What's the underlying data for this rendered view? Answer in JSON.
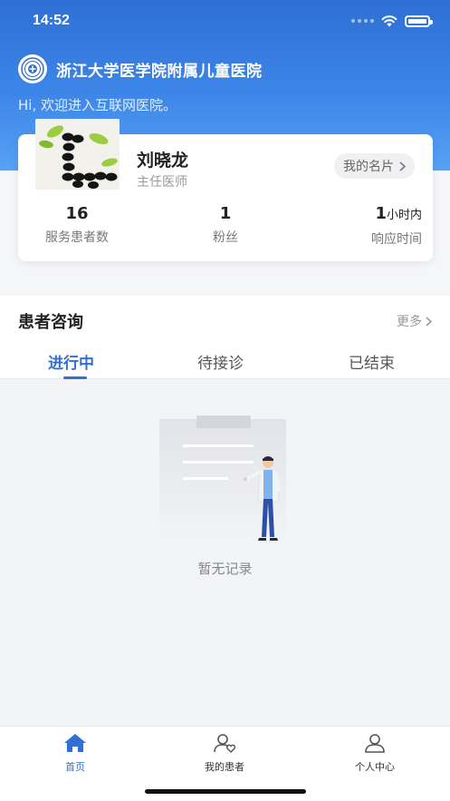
{
  "status_bar": {
    "time": "14:52"
  },
  "header": {
    "hospital_name": "浙江大学医学院附属儿童医院",
    "welcome": "Hi, 欢迎进入互联网医院。"
  },
  "doctor": {
    "name": "刘晓龙",
    "title": "主任医师",
    "card_button": "我的名片",
    "stats": [
      {
        "value": "16",
        "unit": "",
        "label": "服务患者数"
      },
      {
        "value": "1",
        "unit": "",
        "label": "粉丝"
      },
      {
        "value": "1",
        "unit": "小时内",
        "label": "响应时间"
      }
    ]
  },
  "consult": {
    "title": "患者咨询",
    "more": "更多",
    "tabs": [
      "进行中",
      "待接诊",
      "已结束"
    ],
    "active_tab": 0,
    "empty_text": "暂无记录"
  },
  "tab_bar": {
    "items": [
      {
        "label": "首页",
        "icon": "home-icon"
      },
      {
        "label": "我的患者",
        "icon": "patients-icon"
      },
      {
        "label": "个人中心",
        "icon": "user-icon"
      }
    ],
    "active": 0
  },
  "colors": {
    "primary": "#2f6fd6",
    "header_top": "#2e6fd3",
    "header_bottom": "#56a2f4",
    "page_bg": "#f3f4f7"
  }
}
